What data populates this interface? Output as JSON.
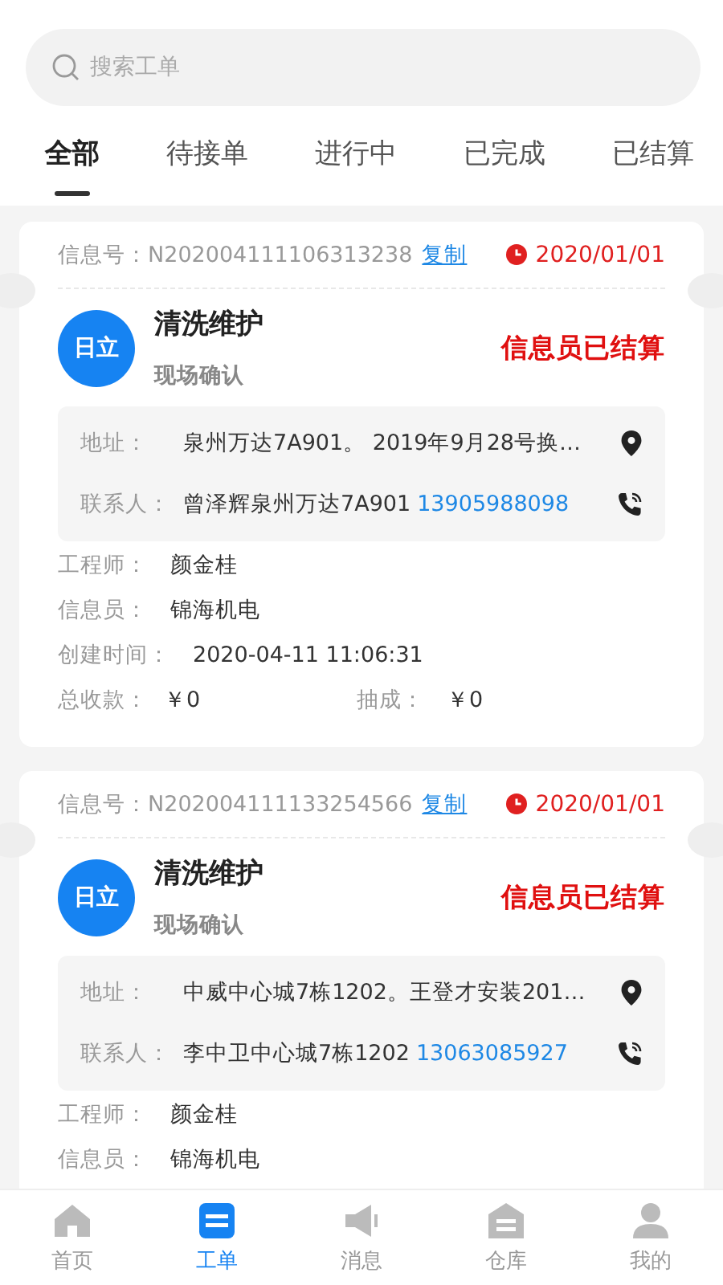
{
  "search": {
    "placeholder": "搜索工单"
  },
  "tabs": [
    {
      "label": "全部",
      "selected": true
    },
    {
      "label": "待接单",
      "selected": false
    },
    {
      "label": "进行中",
      "selected": false
    },
    {
      "label": "已完成",
      "selected": false
    },
    {
      "label": "已结算",
      "selected": false
    }
  ],
  "orders": [
    {
      "id_label": "信息号：",
      "id": "N202004111106313238",
      "copy": "复制",
      "date": "2020/01/01",
      "brand": "日立",
      "title": "清洗维护",
      "subtitle": "现场确认",
      "status": "信息员已结算",
      "address_label": "地址：",
      "address": "泉州万达7A901。 2019年9月28号换…",
      "contact_label": "联系人：",
      "contact": "曾泽辉泉州万达7A901",
      "phone": "13905988098",
      "fields": [
        {
          "label": "工程师：",
          "value": "颜金桂"
        },
        {
          "label": "信息员：",
          "value": "锦海机电"
        },
        {
          "label": "创建时间：",
          "value": "2020-04-11 11:06:31"
        }
      ],
      "totals": [
        {
          "label": "总收款：",
          "value": "￥0"
        },
        {
          "label": "抽成：",
          "value": "￥0"
        }
      ]
    },
    {
      "id_label": "信息号：",
      "id": "N202004111133254566",
      "copy": "复制",
      "date": "2020/01/01",
      "brand": "日立",
      "title": "清洗维护",
      "subtitle": "现场确认",
      "status": "信息员已结算",
      "address_label": "地址：",
      "address": "中威中心城7栋1202。王登才安装201…",
      "contact_label": "联系人：",
      "contact": "李中卫中心城7栋1202",
      "phone": "13063085927",
      "fields": [
        {
          "label": "工程师：",
          "value": "颜金桂"
        },
        {
          "label": "信息员：",
          "value": "锦海机电"
        }
      ]
    }
  ],
  "nav": [
    {
      "kind": "home",
      "label": "首页",
      "selected": false
    },
    {
      "kind": "orders",
      "label": "工单",
      "selected": true
    },
    {
      "kind": "message",
      "label": "消息",
      "selected": false
    },
    {
      "kind": "warehouse",
      "label": "仓库",
      "selected": false
    },
    {
      "kind": "profile",
      "label": "我的",
      "selected": false
    }
  ]
}
